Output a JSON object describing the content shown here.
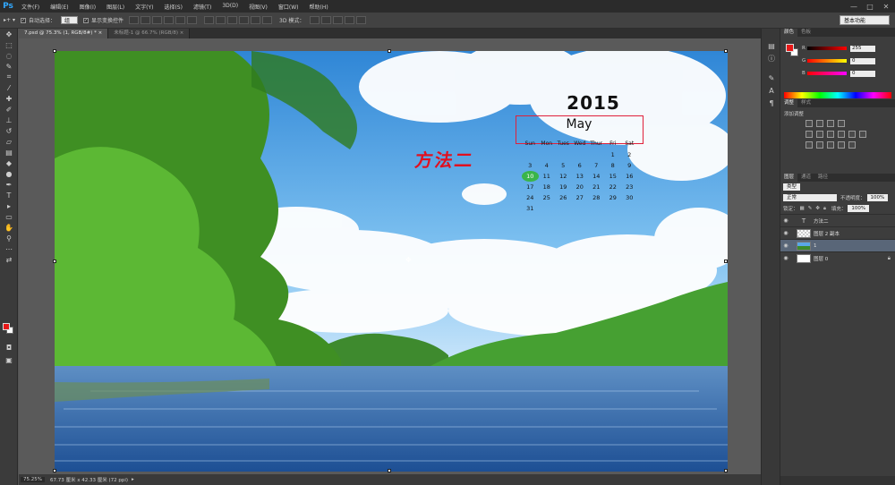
{
  "app": {
    "logo": "Ps"
  },
  "menu": [
    "文件(F)",
    "编辑(E)",
    "图像(I)",
    "图层(L)",
    "文字(Y)",
    "选择(S)",
    "滤镜(T)",
    "3D(D)",
    "视图(V)",
    "窗口(W)",
    "帮助(H)"
  ],
  "window_controls": [
    "—",
    "□",
    "✕"
  ],
  "options": {
    "auto_select_label": "自动选择：",
    "auto_select_value": "组",
    "show_transform_label": "显示变换控件",
    "mode_3d_label": "3D 模式：",
    "workspace": "基本功能"
  },
  "doc_tabs": [
    {
      "label": "7.psd @ 75.3% (1, RGB/8#) *",
      "close": "×"
    },
    {
      "label": "未标题-1 @ 66.7% (RGB/8)",
      "close": "×"
    }
  ],
  "calendar": {
    "year": "2015",
    "month": "May",
    "weekdays": [
      "Sun",
      "Mon",
      "Tues",
      "Wed",
      "Thur",
      "Fri",
      "Sat"
    ],
    "weeks": [
      [
        "",
        "",
        "",
        "",
        "",
        "1",
        "2"
      ],
      [
        "3",
        "4",
        "5",
        "6",
        "7",
        "8",
        "9"
      ],
      [
        "10",
        "11",
        "12",
        "13",
        "14",
        "15",
        "16"
      ],
      [
        "17",
        "18",
        "19",
        "20",
        "21",
        "22",
        "23"
      ],
      [
        "24",
        "25",
        "26",
        "27",
        "28",
        "29",
        "30"
      ],
      [
        "31",
        "",
        "",
        "",
        "",
        "",
        ""
      ]
    ],
    "highlighted_day": "10",
    "annotation": "方法二",
    "highlight_color": "#3ab54a",
    "annotation_color": "#e01020"
  },
  "status": {
    "zoom": "75.25%",
    "doc_info": "67.73 厘米 x 42.33 厘米 (72 ppi)"
  },
  "colors": {
    "foreground": "#e81818",
    "background": "#ffffff"
  },
  "color_panel": {
    "tabs": [
      "颜色",
      "色板"
    ],
    "r_label": "R",
    "r_value": "255",
    "g_label": "G",
    "g_value": "0",
    "b_label": "B",
    "b_value": "0"
  },
  "adjust_panel": {
    "tabs": [
      "调整",
      "样式"
    ],
    "title": "添加调整"
  },
  "layers_panel": {
    "tabs": [
      "图层",
      "通道",
      "路径"
    ],
    "kind_filter": "类型",
    "blend_mode": "正常",
    "opacity_label": "不透明度：",
    "opacity_value": "100%",
    "lock_label": "锁定：",
    "fill_label": "填充：",
    "fill_value": "100%",
    "layers": [
      {
        "name": "方法二",
        "type": "text"
      },
      {
        "name": "图层 2 副本",
        "type": "checker"
      },
      {
        "name": "1",
        "type": "img",
        "selected": true
      },
      {
        "name": "图层 0",
        "type": "white",
        "locked": true
      }
    ]
  }
}
